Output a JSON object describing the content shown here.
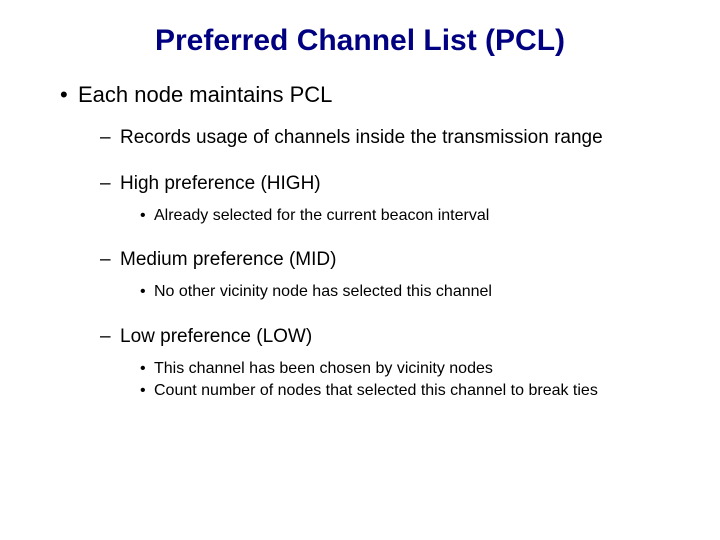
{
  "title": "Preferred Channel List (PCL)",
  "bullet_l1": "•",
  "bullet_l2": "–",
  "bullet_l3": "•",
  "l1_item": "Each node maintains PCL",
  "records": "Records usage of channels inside the transmission range",
  "high": {
    "label": "High preference (HIGH)",
    "sub1": "Already selected for the current beacon interval"
  },
  "mid": {
    "label": "Medium preference (MID)",
    "sub1": "No other vicinity node has selected this channel"
  },
  "low": {
    "label": "Low preference (LOW)",
    "sub1": "This channel has been chosen by vicinity nodes",
    "sub2": "Count number of nodes that selected this channel to break ties"
  }
}
